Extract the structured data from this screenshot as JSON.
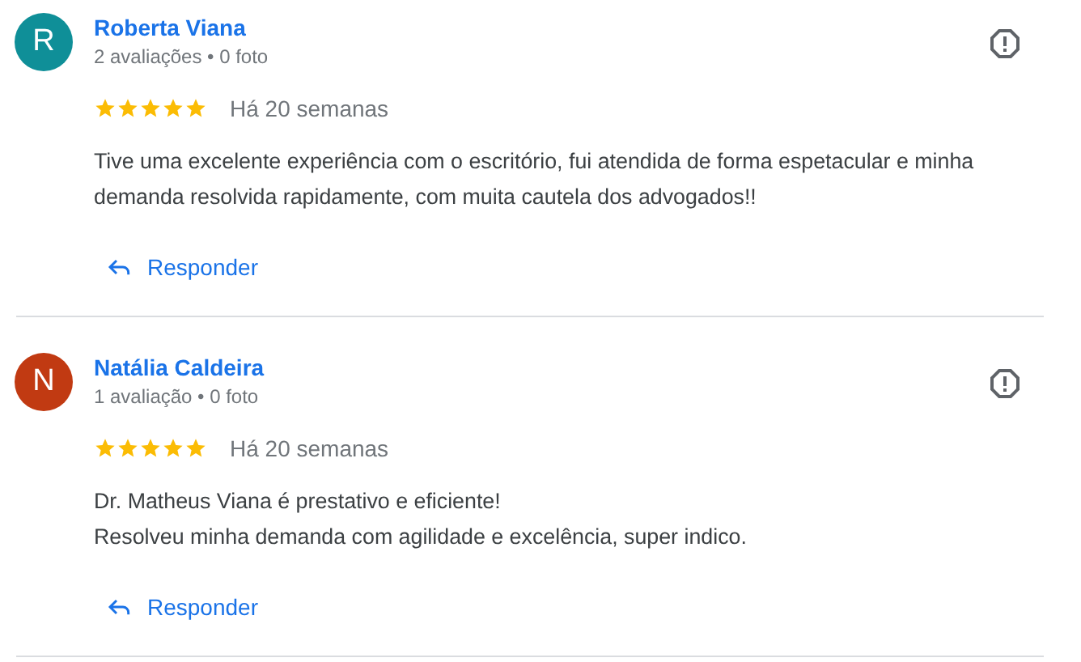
{
  "reviews": [
    {
      "initial": "R",
      "color": "#0f8f98",
      "name": "Roberta Viana",
      "meta": "2 avaliações • 0 foto",
      "stars": 5,
      "time": "Há 20 semanas",
      "text_lines": [
        "Tive uma excelente experiência com o escritório, fui atendida de forma espetacular e minha",
        "demanda resolvida rapidamente, com muita cautela dos advogados!!"
      ],
      "reply": "Responder"
    },
    {
      "initial": "N",
      "color": "#c13a12",
      "name": "Natália Caldeira",
      "meta": "1 avaliação • 0 foto",
      "stars": 5,
      "time": "Há 20 semanas",
      "text_lines": [
        "Dr. Matheus Viana é prestativo e eficiente!",
        "Resolveu minha demanda com agilidade e excelência, super indico."
      ],
      "reply": "Responder"
    }
  ]
}
